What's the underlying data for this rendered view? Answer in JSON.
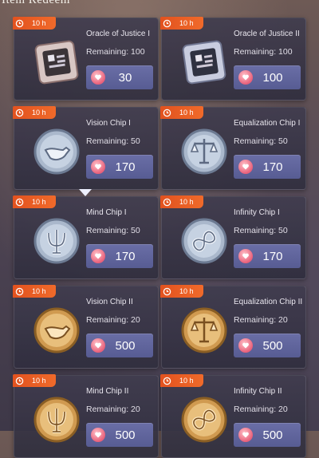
{
  "page_title": "Item Redeem",
  "cards": [
    {
      "timer": "10 h",
      "name": "Oracle of Justice I",
      "remaining": "Remaining: 100",
      "price": "30",
      "icon": "oracle-chip-icon"
    },
    {
      "timer": "10 h",
      "name": "Oracle of Justice II",
      "remaining": "Remaining: 100",
      "price": "100",
      "icon": "oracle-chip-icon"
    },
    {
      "timer": "10 h",
      "name": "Vision Chip I",
      "remaining": "Remaining: 50",
      "price": "170",
      "icon": "pipe-coin-icon"
    },
    {
      "timer": "10 h",
      "name": "Equalization Chip I",
      "remaining": "Remaining: 50",
      "price": "170",
      "icon": "scales-coin-icon"
    },
    {
      "timer": "10 h",
      "name": "Mind Chip I",
      "remaining": "Remaining: 50",
      "price": "170",
      "icon": "psi-coin-icon"
    },
    {
      "timer": "10 h",
      "name": "Infinity Chip I",
      "remaining": "Remaining: 50",
      "price": "170",
      "icon": "infinity-coin-icon"
    },
    {
      "timer": "10 h",
      "name": "Vision Chip II",
      "remaining": "Remaining: 20",
      "price": "500",
      "icon": "pipe-coin-icon"
    },
    {
      "timer": "10 h",
      "name": "Equalization Chip II",
      "remaining": "Remaining: 20",
      "price": "500",
      "icon": "scales-coin-icon"
    },
    {
      "timer": "10 h",
      "name": "Mind Chip II",
      "remaining": "Remaining: 20",
      "price": "500",
      "icon": "psi-coin-icon"
    },
    {
      "timer": "10 h",
      "name": "Infinity Chip II",
      "remaining": "Remaining: 20",
      "price": "500",
      "icon": "infinity-coin-icon"
    }
  ],
  "colors": {
    "timer_tag": "#e85a22",
    "price_button": "#5f64a0",
    "silver_coin": "#b9c7d8",
    "gold_coin": "#d9a860"
  }
}
